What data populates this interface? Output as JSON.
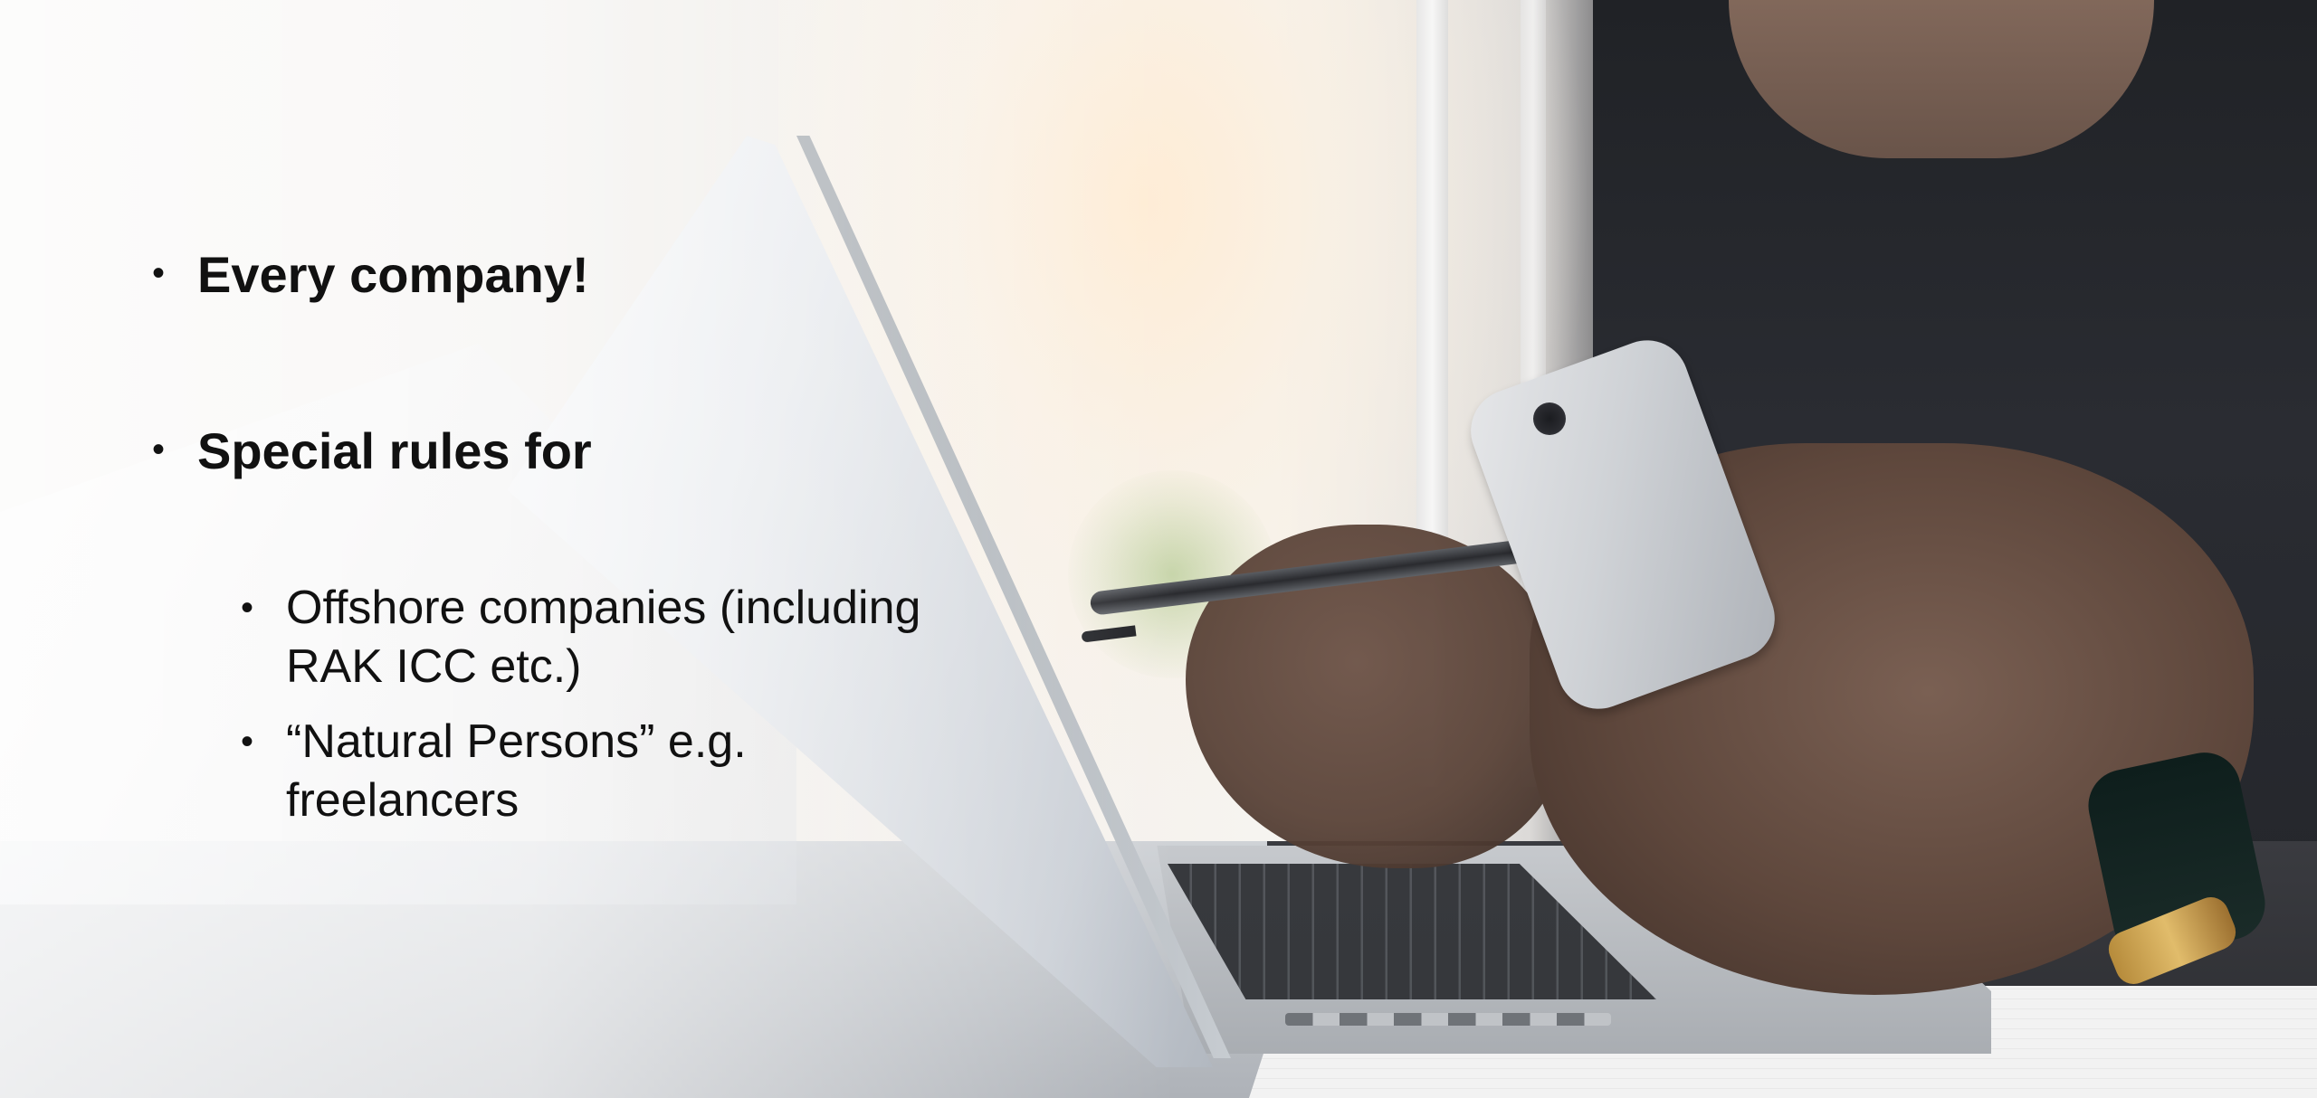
{
  "slide": {
    "bullets": [
      {
        "text": "Every company!",
        "level": 1
      },
      {
        "text": "Special rules for",
        "level": 1
      },
      {
        "text": "Offshore companies (including RAK ICC etc.)",
        "level": 2
      },
      {
        "text": "“Natural Persons” e.g. freelancers",
        "level": 2
      }
    ],
    "colors": {
      "text": "#111111",
      "wash": "#ffffff"
    }
  }
}
